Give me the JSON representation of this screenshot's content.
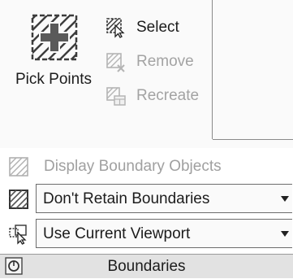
{
  "commands": {
    "pick_points": "Pick Points",
    "select": "Select",
    "remove": "Remove",
    "recreate": "Recreate"
  },
  "options": {
    "display_boundary_objects": "Display Boundary Objects",
    "retain_boundaries": "Don't Retain Boundaries",
    "boundary_set": "Use Current Viewport"
  },
  "panel": {
    "title": "Boundaries"
  },
  "icons": {
    "pick_points": "hatch-pick-point-icon",
    "select": "hatch-select-icon",
    "remove": "hatch-remove-icon",
    "recreate": "hatch-recreate-icon",
    "display_boundary_objects": "hatch-display-icon",
    "retain_boundaries": "hatch-retain-icon",
    "boundary_set": "viewport-select-icon",
    "panel": "panel-expand-icon"
  },
  "colors": {
    "enabled_text": "#1c1c1c",
    "disabled_text": "#a3a3a3",
    "panel_footer": "#e2e2e2"
  }
}
